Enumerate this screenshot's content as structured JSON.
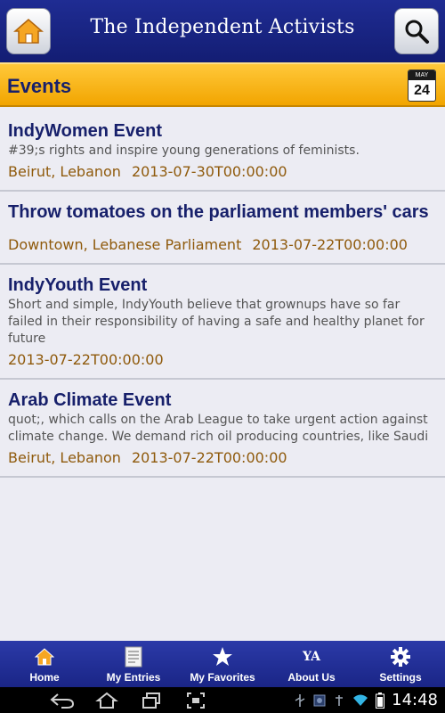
{
  "header": {
    "title": "The Independent Activists",
    "home_icon": "home-icon",
    "search_icon": "search-icon"
  },
  "section": {
    "title": "Events",
    "calendar": {
      "month": "MAY",
      "day": "24"
    }
  },
  "events": [
    {
      "title": "IndyWomen Event",
      "description": "#39;s rights and inspire young generations of feminists.",
      "location": "Beirut, Lebanon",
      "date": "2013-07-30T00:00:00"
    },
    {
      "title": "Throw tomatoes on the parliament members' cars",
      "description": "",
      "location": "Downtown, Lebanese Parliament",
      "date": "2013-07-22T00:00:00"
    },
    {
      "title": "IndyYouth Event",
      "description": "Short and simple, IndyYouth believe that grownups have so far failed in their responsibility of having a safe and healthy planet for future",
      "location": "",
      "date": "2013-07-22T00:00:00"
    },
    {
      "title": "Arab Climate Event",
      "description": "quot;, which calls on the Arab League to take urgent action against climate change. We demand rich oil producing countries, like Saudi",
      "location": "Beirut, Lebanon",
      "date": "2013-07-22T00:00:00"
    }
  ],
  "bottom_nav": [
    {
      "label": "Home",
      "icon": "home-icon"
    },
    {
      "label": "My Entries",
      "icon": "document-icon"
    },
    {
      "label": "My Favorites",
      "icon": "star-icon"
    },
    {
      "label": "About Us",
      "icon": "ya-logo-icon",
      "icon_text": "YA"
    },
    {
      "label": "Settings",
      "icon": "gear-icon"
    }
  ],
  "system_bar": {
    "time": "14:48"
  },
  "colors": {
    "header_bg": "#1a2586",
    "section_bar": "#f7b81a",
    "title_text": "#17206b",
    "meta_text": "#8f5a0c"
  }
}
